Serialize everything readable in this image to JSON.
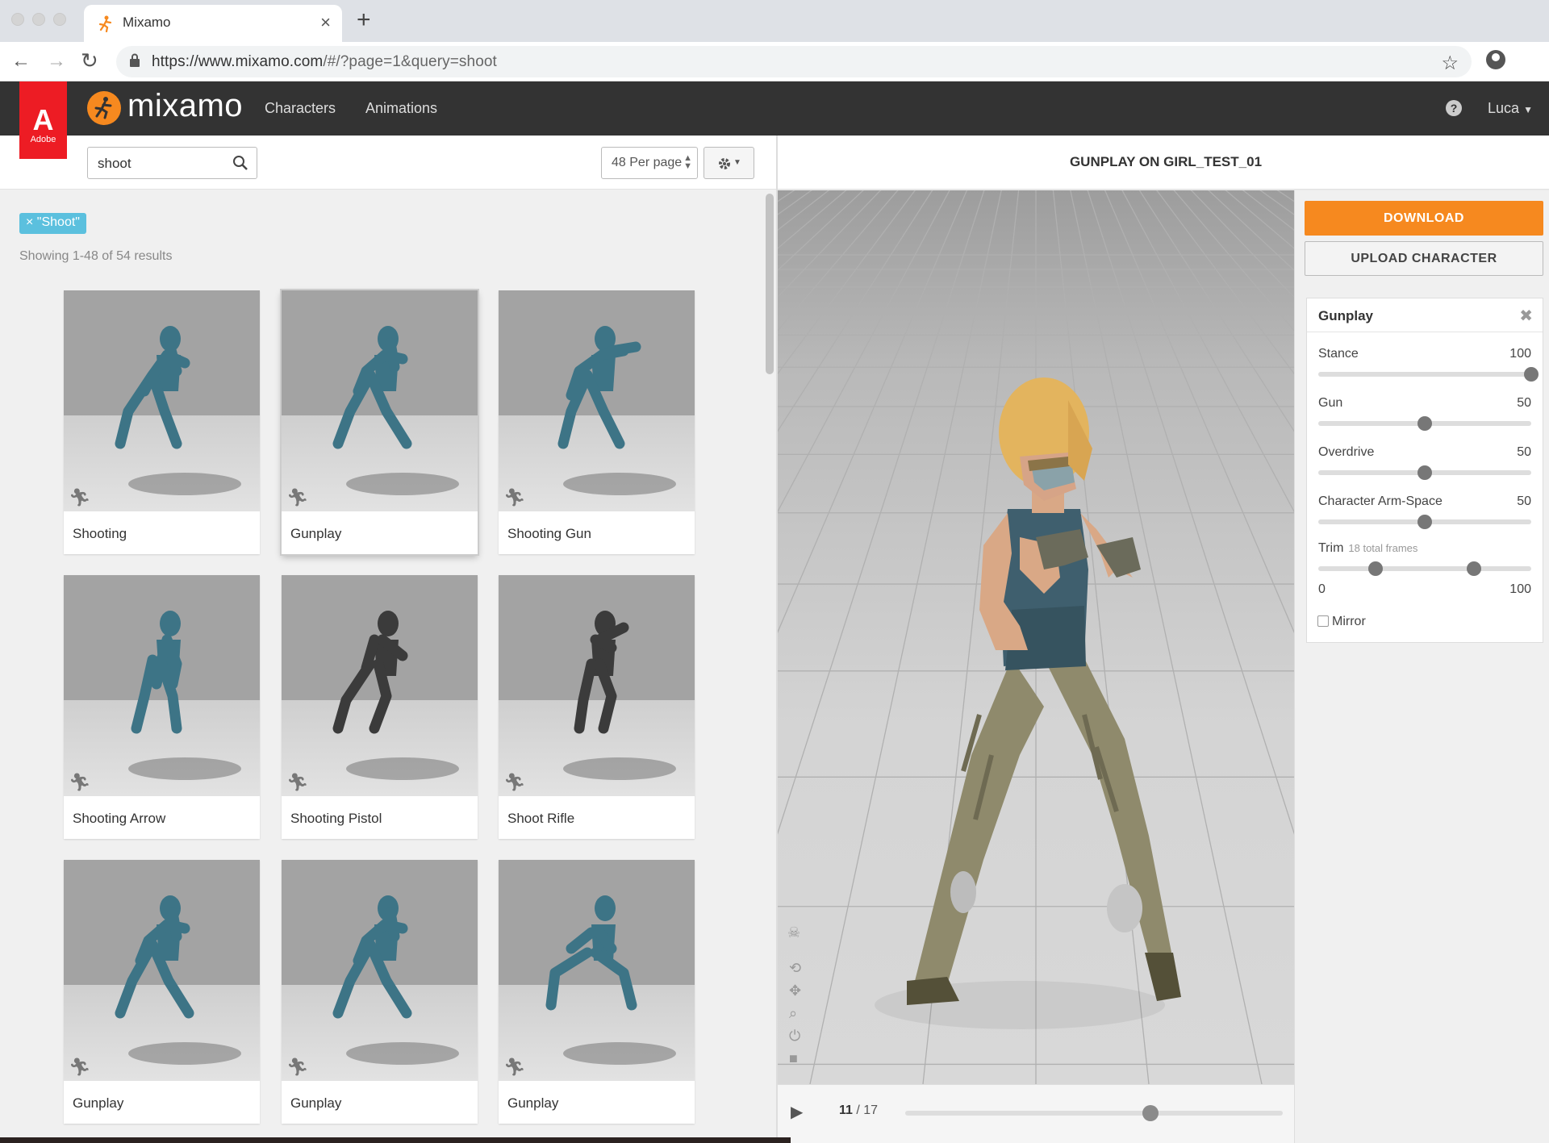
{
  "browser": {
    "tab_title": "Mixamo",
    "url_host": "https://www.mixamo.com",
    "url_path": "/#/?page=1&query=shoot"
  },
  "app": {
    "adobe_label": "Adobe",
    "logo_text": "mixamo",
    "nav": [
      "Characters",
      "Animations"
    ],
    "user": "Luca"
  },
  "search": {
    "value": "shoot",
    "per_page": "48 Per page",
    "filter_chip": "× \"Shoot\"",
    "results_text": "Showing 1-48 of 54 results"
  },
  "cards": [
    {
      "label": "Shooting"
    },
    {
      "label": "Gunplay"
    },
    {
      "label": "Shooting Gun"
    },
    {
      "label": "Shooting Arrow"
    },
    {
      "label": "Shooting Pistol"
    },
    {
      "label": "Shoot Rifle"
    },
    {
      "label": "Gunplay"
    },
    {
      "label": "Gunplay"
    },
    {
      "label": "Gunplay"
    }
  ],
  "preview": {
    "title": "GUNPLAY ON GIRL_TEST_01",
    "frame_current": "11",
    "frame_total": "/ 17",
    "timeline_progress": 0.65
  },
  "panel": {
    "download": "DOWNLOAD",
    "upload": "UPLOAD CHARACTER",
    "settings_title": "Gunplay",
    "sliders": [
      {
        "name": "Stance",
        "value": "100",
        "level": 1.0
      },
      {
        "name": "Gun",
        "value": "50",
        "level": 0.5
      },
      {
        "name": "Overdrive",
        "value": "50",
        "level": 0.5
      },
      {
        "name": "Character Arm-Space",
        "value": "50",
        "level": 0.5
      }
    ],
    "trim_label": "Trim",
    "trim_frames": "18 total frames",
    "trim_min": "0",
    "trim_max": "100",
    "trim_range": [
      0.27,
      0.73
    ],
    "mirror_label": "Mirror"
  },
  "colors": {
    "accent": "#f6891f",
    "chip": "#5bc0de",
    "header": "#333333",
    "adobe": "#ed1c24"
  }
}
